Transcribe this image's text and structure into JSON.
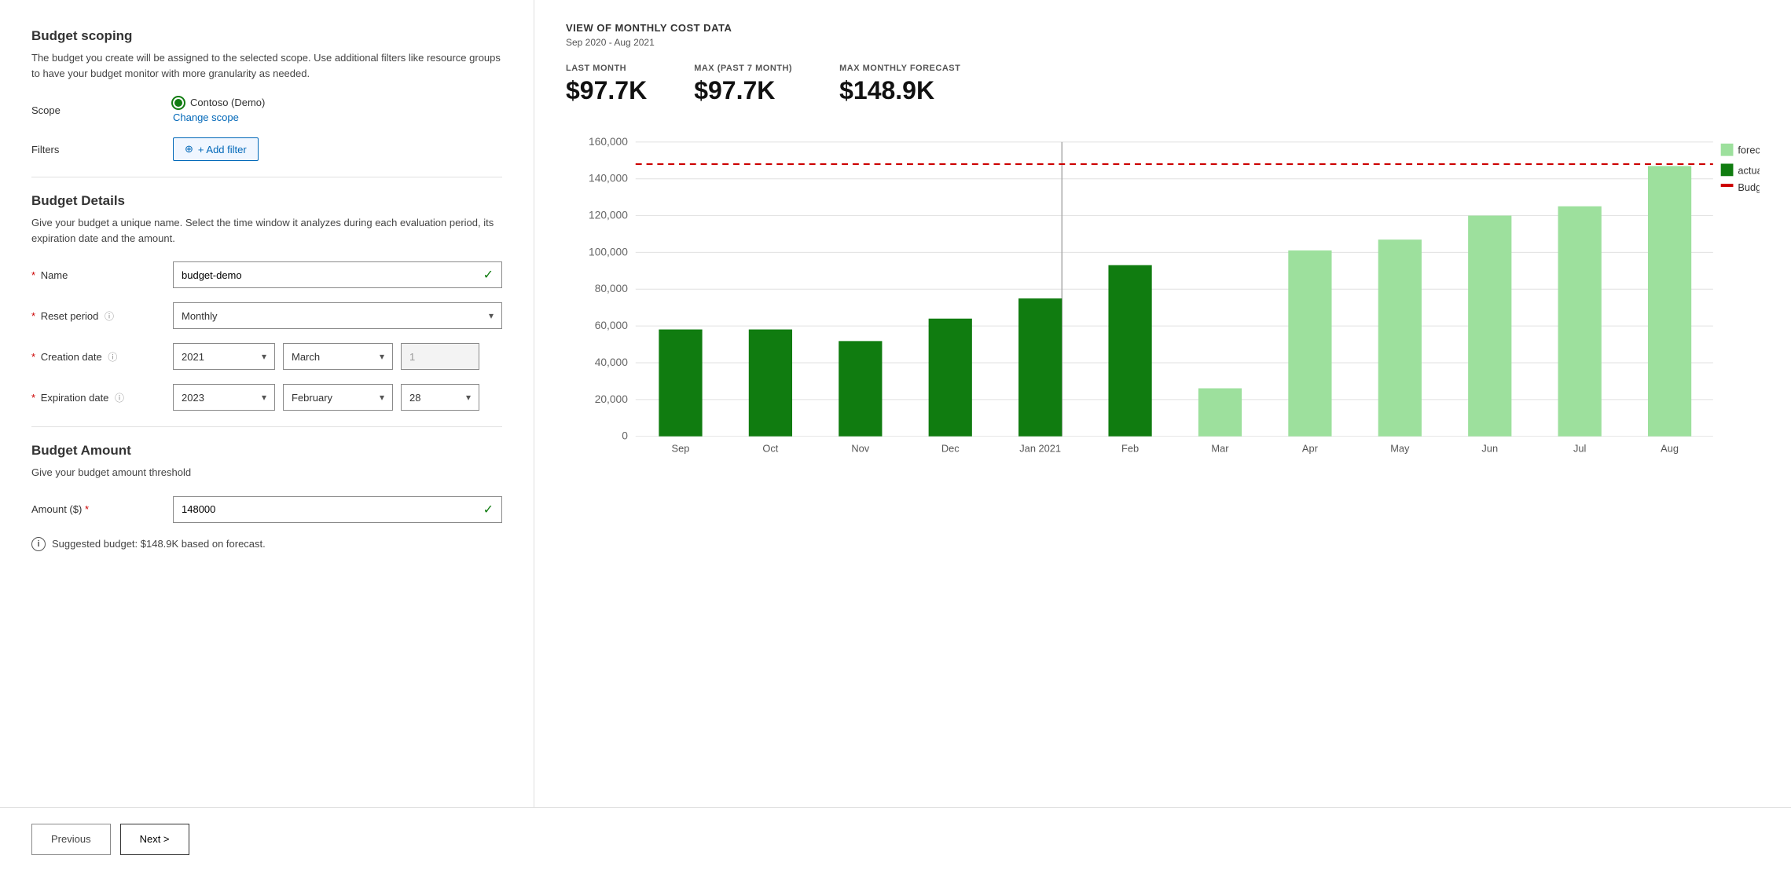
{
  "left": {
    "budget_scoping_title": "Budget scoping",
    "budget_scoping_desc": "The budget you create will be assigned to the selected scope. Use additional filters like resource groups to have your budget monitor with more granularity as needed.",
    "scope_label": "Scope",
    "scope_dot_color": "#107c10",
    "scope_name": "Contoso (Demo)",
    "change_scope_link": "Change scope",
    "filters_label": "Filters",
    "add_filter_btn": "+ Add filter",
    "budget_details_title": "Budget Details",
    "budget_details_desc": "Give your budget a unique name. Select the time window it analyzes during each evaluation period, its expiration date and the amount.",
    "name_label": "Name",
    "name_value": "budget-demo",
    "reset_period_label": "Reset period",
    "reset_period_value": "Monthly",
    "creation_date_label": "Creation date",
    "creation_year": "2021",
    "creation_month": "March",
    "creation_day": "1",
    "expiration_date_label": "Expiration date",
    "expiration_year": "2023",
    "expiration_month": "February",
    "expiration_day": "28",
    "budget_amount_title": "Budget Amount",
    "budget_amount_desc": "Give your budget amount threshold",
    "amount_label": "Amount ($)",
    "amount_value": "148000",
    "suggestion_text": "Suggested budget: $148.9K based on forecast."
  },
  "right": {
    "chart_title": "VIEW OF MONTHLY COST DATA",
    "chart_subtitle": "Sep 2020 - Aug 2021",
    "stat_last_month_label": "LAST MONTH",
    "stat_last_month_value": "$97.7K",
    "stat_max_label": "MAX (PAST 7 MONTH)",
    "stat_max_value": "$97.7K",
    "stat_forecast_label": "MAX MONTHLY FORECAST",
    "stat_forecast_value": "$148.9K",
    "legend": {
      "forecast_label": "forecast",
      "actual_label": "actual",
      "budget_label": "Budget"
    },
    "chart_data": {
      "months": [
        "Sep",
        "Oct",
        "Nov",
        "Dec",
        "Jan 2021",
        "Feb",
        "Mar",
        "Apr",
        "May",
        "Jun",
        "Jul",
        "Aug"
      ],
      "actual": [
        58000,
        58000,
        52000,
        64000,
        75000,
        93000,
        0,
        0,
        0,
        0,
        0,
        0
      ],
      "forecast": [
        0,
        0,
        0,
        0,
        0,
        0,
        26000,
        101000,
        107000,
        120000,
        125000,
        138000,
        148000
      ],
      "budget_line": 148000,
      "y_max": 160000,
      "y_labels": [
        "160,000",
        "140,000",
        "120,000",
        "100,000",
        "80,000",
        "60,000",
        "40,000",
        "20,000",
        "0"
      ]
    }
  },
  "footer": {
    "prev_label": "Previous",
    "next_label": "Next >"
  }
}
